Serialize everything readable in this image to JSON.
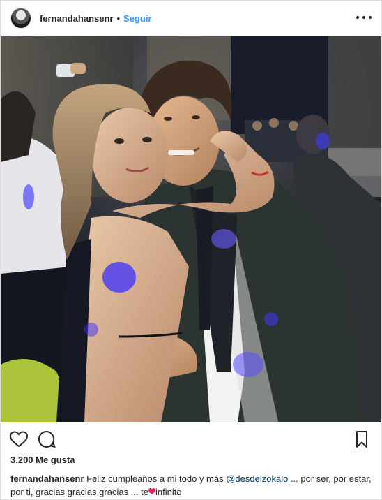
{
  "header": {
    "username": "fernandahansenr",
    "separator": "•",
    "follow_label": "Seguir"
  },
  "photo": {
    "alt": "Pareja abrazada en una fiesta"
  },
  "actions": {
    "like_icon": "heart-outline-icon",
    "comment_icon": "comment-bubble-icon",
    "save_icon": "bookmark-icon"
  },
  "likes": {
    "text": "3.200 Me gusta"
  },
  "caption": {
    "username": "fernandahansenr",
    "text_before_mention": " Feliz cumpleaños a mi todo y más ",
    "mention": "@desdelzokalo",
    "text_after_mention": " ... por ser, por estar, por ti, gracias gracias gracias ... te",
    "emoji": "heart-emoji",
    "text_end": "infinito"
  },
  "colors": {
    "link_blue": "#3897f0",
    "mention_blue": "#003569",
    "text": "#262626",
    "border": "#dbdbdb"
  }
}
